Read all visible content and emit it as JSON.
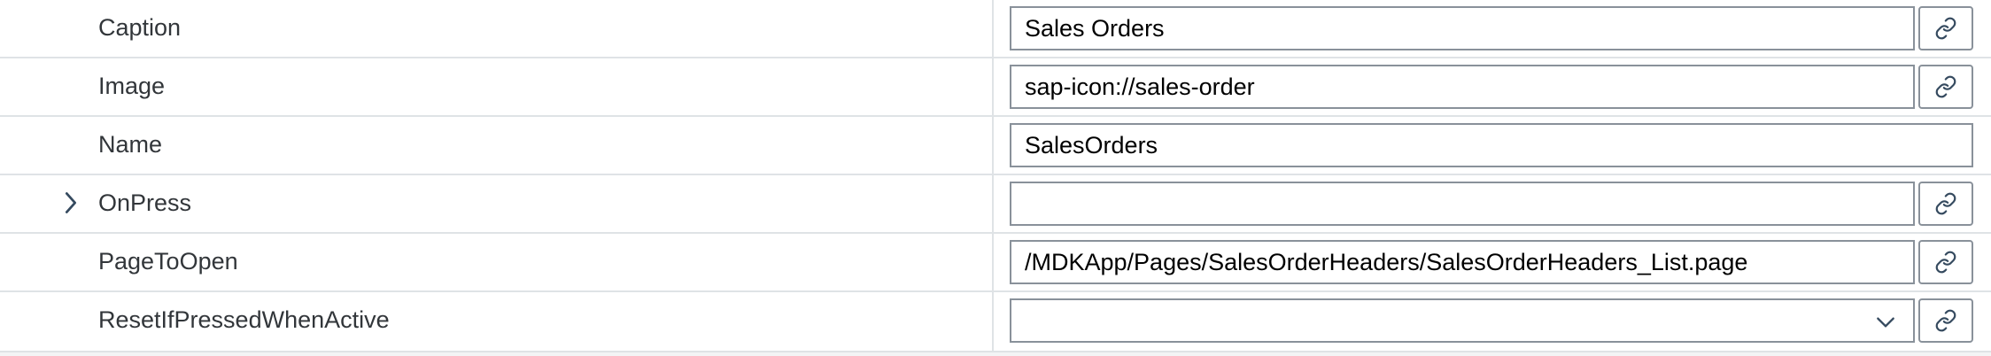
{
  "properties": [
    {
      "label": "Caption",
      "value": "Sales Orders",
      "expandable": false,
      "has_link": true,
      "kind": "text"
    },
    {
      "label": "Image",
      "value": "sap-icon://sales-order",
      "expandable": false,
      "has_link": true,
      "kind": "text"
    },
    {
      "label": "Name",
      "value": "SalesOrders",
      "expandable": false,
      "has_link": false,
      "kind": "text"
    },
    {
      "label": "OnPress",
      "value": "",
      "expandable": true,
      "has_link": true,
      "kind": "text"
    },
    {
      "label": "PageToOpen",
      "value": "/MDKApp/Pages/SalesOrderHeaders/SalesOrderHeaders_List.page",
      "expandable": false,
      "has_link": true,
      "kind": "text"
    },
    {
      "label": "ResetIfPressedWhenActive",
      "value": "",
      "expandable": false,
      "has_link": true,
      "kind": "select"
    }
  ],
  "icons": {
    "expander": "chevron-right-icon",
    "link": "link-icon",
    "dropdown": "chevron-down-icon"
  },
  "colors": {
    "accent": "#0a6ed1",
    "border": "#89919a",
    "divider": "#dfe3e6",
    "text": "#32363a",
    "icon": "#354a5f"
  }
}
